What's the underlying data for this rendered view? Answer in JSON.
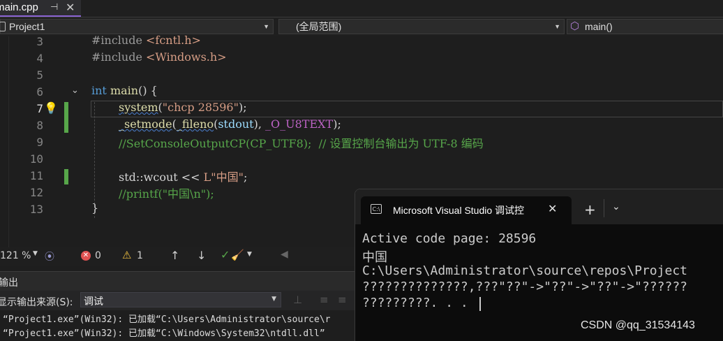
{
  "tab": {
    "filename": "main.cpp",
    "pin": "⊣",
    "close": "✕"
  },
  "nav": {
    "project": "Project1",
    "scope": "(全局范围)",
    "function": "main()"
  },
  "editor": {
    "line_numbers": [
      "3",
      "4",
      "5",
      "6",
      "7",
      "8",
      "9",
      "10",
      "11",
      "12",
      "13"
    ],
    "lines": {
      "l3_directive": "#include ",
      "l3_header": "<fcntl.h>",
      "l4_directive": "#include ",
      "l4_header": "<Windows.h>",
      "l6_kw": "int",
      "l6_sp": " ",
      "l6_fn": "main",
      "l6_rest": "() {",
      "l7_fn": "system",
      "l7_open": "(",
      "l7_str": "\"chcp 28596\"",
      "l7_close": ");",
      "l8_fn1": "_setmode",
      "l8_p1": "(",
      "l8_fn2": "_fileno",
      "l8_p2": "(",
      "l8_id": "stdout",
      "l8_p3": "), ",
      "l8_mc": "_O_U8TEXT",
      "l8_p4": ");",
      "l9_comment": "//SetConsoleOutputCP(CP_UTF8);  // 设置控制台输出为 UTF-8 编码",
      "l11_pre": "std::wcout << ",
      "l11_str": "L\"中国\"",
      "l11_end": ";",
      "l12_comment": "//printf(\"中国\\n\");",
      "l13": "}"
    }
  },
  "statusbar": {
    "zoom": "121 %",
    "errors": "0",
    "warnings": "1"
  },
  "output": {
    "panel_title": "输出",
    "source_label": "显示输出来源(S):",
    "source_value": "调试",
    "lines": [
      "“Project1.exe”(Win32): 已加载“C:\\Users\\Administrator\\source\\r",
      "“Project1.exe”(Win32): 已加载“C:\\Windows\\System32\\ntdll.dll”"
    ]
  },
  "terminal": {
    "title": "Microsoft Visual Studio 调试控",
    "add": "+",
    "lines": [
      "Active code page: 28596",
      "中国",
      "C:\\Users\\Administrator\\source\\repos\\Project",
      "??????????????,???\"??\"->\"??\"->\"??\"->\"??????",
      "?????????. . ."
    ]
  },
  "watermark": "CSDN @qq_31534143",
  "colors": {
    "keyword": "#569cd6",
    "function": "#dcdcaa",
    "string": "#d69d85",
    "comment": "#57a64a",
    "macro": "#bd63c5",
    "accent": "#8a63d2"
  }
}
